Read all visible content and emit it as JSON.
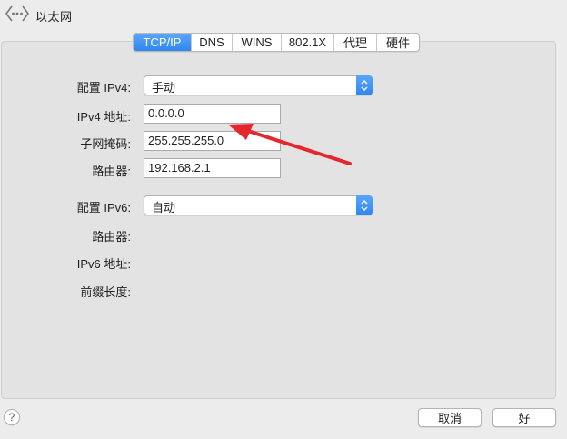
{
  "window": {
    "title": "以太网",
    "icon": "ethernet-icon"
  },
  "tabs": [
    {
      "label": "TCP/IP",
      "active": true
    },
    {
      "label": "DNS",
      "active": false
    },
    {
      "label": "WINS",
      "active": false
    },
    {
      "label": "802.1X",
      "active": false
    },
    {
      "label": "代理",
      "active": false
    },
    {
      "label": "硬件",
      "active": false
    }
  ],
  "ipv4": {
    "config_label": "配置 IPv4:",
    "config_value": "手动",
    "address_label": "IPv4 地址:",
    "address_value": "0.0.0.0",
    "subnet_label": "子网掩码:",
    "subnet_value": "255.255.255.0",
    "router_label": "路由器:",
    "router_value": "192.168.2.1"
  },
  "ipv6": {
    "config_label": "配置 IPv6:",
    "config_value": "自动",
    "router_label": "路由器:",
    "address_label": "IPv6 地址:",
    "prefix_label": "前缀长度:"
  },
  "buttons": {
    "help": "?",
    "cancel": "取消",
    "ok": "好"
  },
  "colors": {
    "accent": "#2f86f1",
    "annotation": "#e5262d"
  }
}
